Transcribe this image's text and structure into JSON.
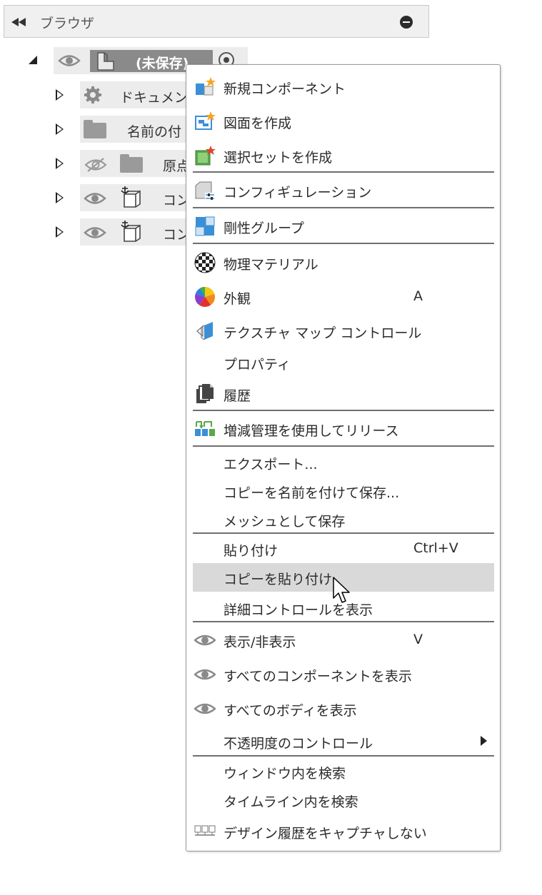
{
  "browser": {
    "title": "ブラウザ",
    "root_label": "(未保存)",
    "items": [
      {
        "label": "ドキュメント"
      },
      {
        "label": "名前の付"
      },
      {
        "label": "原点"
      },
      {
        "label": "コン"
      },
      {
        "label": "コン"
      }
    ]
  },
  "menu": {
    "items": [
      {
        "label": "新規コンポーネント",
        "icon": "new-component-icon"
      },
      {
        "label": "図面を作成",
        "icon": "create-drawing-icon"
      },
      {
        "label": "選択セットを作成",
        "icon": "create-selection-set-icon"
      },
      {
        "label": "コンフィギュレーション",
        "icon": "configuration-icon"
      },
      {
        "label": "剛性グループ",
        "icon": "rigid-group-icon"
      },
      {
        "label": "物理マテリアル",
        "icon": "physical-material-icon"
      },
      {
        "label": "外観",
        "shortcut": "A",
        "icon": "appearance-icon"
      },
      {
        "label": "テクスチャ マップ コントロール",
        "icon": "texture-map-icon"
      },
      {
        "label": "プロパティ"
      },
      {
        "label": "履歴",
        "icon": "history-icon"
      },
      {
        "label": "増減管理を使用してリリース",
        "icon": "release-icon"
      },
      {
        "label": "エクスポート..."
      },
      {
        "label": "コピーを名前を付けて保存..."
      },
      {
        "label": "メッシュとして保存"
      },
      {
        "label": "貼り付け",
        "shortcut": "Ctrl+V"
      },
      {
        "label": "コピーを貼り付け",
        "highlighted": true
      },
      {
        "label": "詳細コントロールを表示"
      },
      {
        "label": "表示/非表示",
        "shortcut": "V",
        "icon": "eye-icon"
      },
      {
        "label": "すべてのコンポーネントを表示",
        "icon": "eye-icon"
      },
      {
        "label": "すべてのボディを表示",
        "icon": "eye-icon"
      },
      {
        "label": "不透明度のコントロール",
        "submenu": true
      },
      {
        "label": "ウィンドウ内を検索"
      },
      {
        "label": "タイムライン内を検索"
      },
      {
        "label": "デザイン履歴をキャプチャしない",
        "icon": "capture-history-icon"
      }
    ]
  },
  "colors": {
    "highlight": "#d9d9d9",
    "separator": "#6f6f6f",
    "blue": "#3b8fd6",
    "star": "#f5a623"
  }
}
